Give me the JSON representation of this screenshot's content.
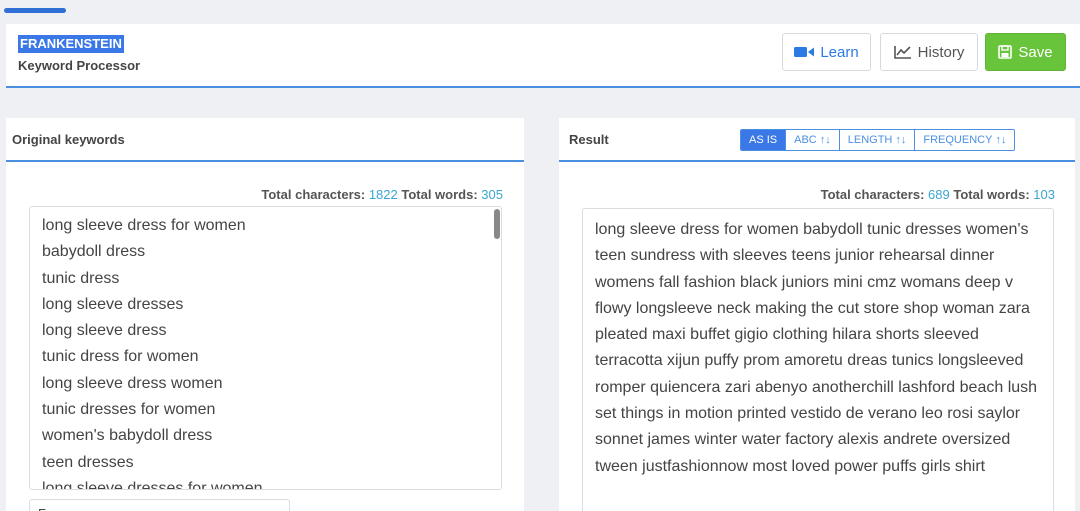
{
  "header": {
    "app_title": "FRANKENSTEIN",
    "app_subtitle": "Keyword Processor",
    "buttons": {
      "learn": "Learn",
      "history": "History",
      "save": "Save"
    }
  },
  "original": {
    "title": "Original keywords",
    "chars_label": "Total characters:",
    "chars_value": "1822",
    "words_label": "Total words:",
    "words_value": "305",
    "keywords": [
      "long sleeve dress for women",
      "babydoll dress",
      "tunic dress",
      "long sleeve dresses",
      "long sleeve dress",
      "tunic dress for women",
      "long sleeve dress women",
      "tunic dresses for women",
      "women's babydoll dress",
      "teen dresses",
      "long sleeve dresses for women"
    ],
    "below_box_text": "F..."
  },
  "result": {
    "title": "Result",
    "sort_options": [
      "AS IS",
      "ABC",
      "LENGTH",
      "FREQUENCY"
    ],
    "active_sort": "AS IS",
    "chars_label": "Total characters:",
    "chars_value": "689",
    "words_label": "Total words:",
    "words_value": "103",
    "text": "long sleeve dress for women babydoll tunic dresses women's teen sundress with sleeves teens junior rehearsal dinner womens fall fashion black juniors mini cmz womans deep v flowy longsleeve neck making the cut store shop woman zara pleated maxi buffet gigio clothing hilara shorts sleeved terracotta xijun puffy prom amoretu dreas tunics longsleeved romper quiencera zari abenyo anotherchill lashford beach lush set things in motion printed vestido de verano leo rosi saylor sonnet james winter water factory alexis andrete oversized tween justfashionnow most loved power puffs girls shirt"
  },
  "colors": {
    "accent_blue": "#4a90e2",
    "save_green": "#68c43b",
    "number_cyan": "#3aa6d0"
  },
  "icons": {
    "learn": "video-camera-icon",
    "history": "line-chart-icon",
    "save": "floppy-disk-icon",
    "sort": "up-down-arrows-icon"
  }
}
